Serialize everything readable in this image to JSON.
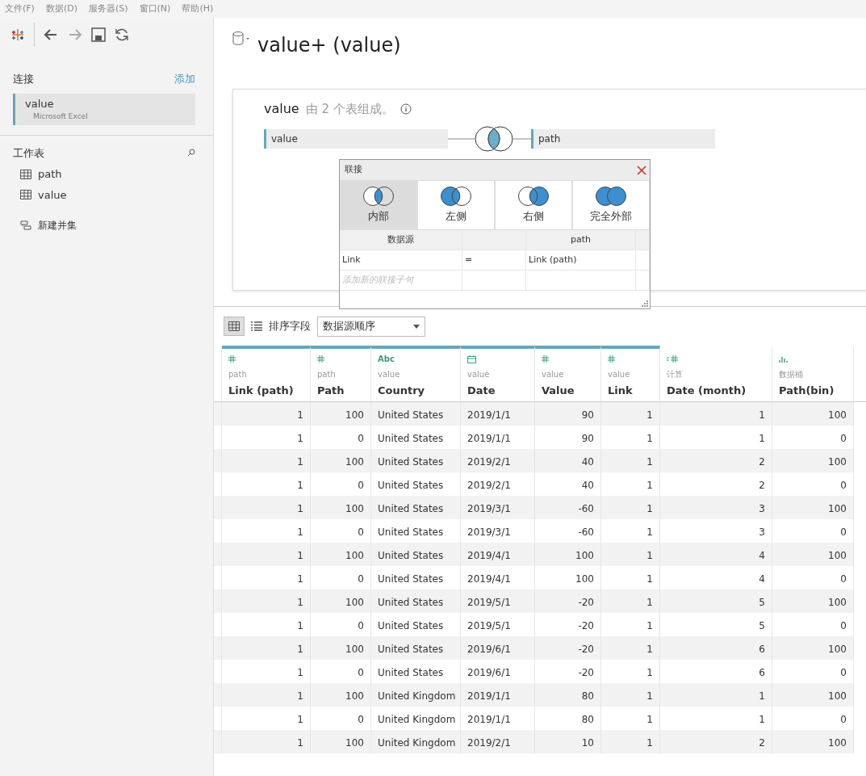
{
  "menu": [
    "文件(F)",
    "数据(D)",
    "服务器(S)",
    "窗口(N)",
    "帮助(H)"
  ],
  "sidebar": {
    "connections_label": "连接",
    "add_link": "添加",
    "connection": {
      "name": "value",
      "type": "Microsoft Excel"
    },
    "sheets_label": "工作表",
    "sheets": [
      "path",
      "value"
    ],
    "new_union": "新建并集"
  },
  "title": "value+ (value)",
  "canvas": {
    "source_name": "value",
    "source_desc": "由 2 个表组成。",
    "left_table": "value",
    "right_table": "path"
  },
  "join_dialog": {
    "title": "联接",
    "types": [
      {
        "label": "内部",
        "kind": "inner",
        "selected": true
      },
      {
        "label": "左侧",
        "kind": "left",
        "selected": false
      },
      {
        "label": "右侧",
        "kind": "right",
        "selected": false
      },
      {
        "label": "完全外部",
        "kind": "full",
        "selected": false
      }
    ],
    "headers": [
      "数据源",
      "path"
    ],
    "clause": {
      "left": "Link",
      "op": "=",
      "right": "Link (path)"
    },
    "add_placeholder": "添加新的联接子句"
  },
  "grid_toolbar": {
    "sort_label": "排序字段",
    "sort_value": "数据源顺序"
  },
  "table": {
    "columns": [
      {
        "name": "Link (path)",
        "source": "path",
        "kind": "number",
        "linked": true
      },
      {
        "name": "Path",
        "source": "path",
        "kind": "number",
        "linked": true
      },
      {
        "name": "Country",
        "source": "value",
        "kind": "string",
        "type_text": "Abc",
        "linked": true
      },
      {
        "name": "Date",
        "source": "value",
        "kind": "date",
        "linked": true
      },
      {
        "name": "Value",
        "source": "value",
        "kind": "number",
        "linked": true
      },
      {
        "name": "Link",
        "source": "value",
        "kind": "number",
        "linked": true
      },
      {
        "name": "Date  (month)",
        "source": "计算",
        "kind": "calc",
        "linked": false
      },
      {
        "name": "Path(bin)",
        "source": "数据桶",
        "kind": "bin",
        "linked": false
      }
    ],
    "rows": [
      [
        "1",
        "100",
        "United States",
        "2019/1/1",
        "90",
        "1",
        "1",
        "100"
      ],
      [
        "1",
        "0",
        "United States",
        "2019/1/1",
        "90",
        "1",
        "1",
        "0"
      ],
      [
        "1",
        "100",
        "United States",
        "2019/2/1",
        "40",
        "1",
        "2",
        "100"
      ],
      [
        "1",
        "0",
        "United States",
        "2019/2/1",
        "40",
        "1",
        "2",
        "0"
      ],
      [
        "1",
        "100",
        "United States",
        "2019/3/1",
        "-60",
        "1",
        "3",
        "100"
      ],
      [
        "1",
        "0",
        "United States",
        "2019/3/1",
        "-60",
        "1",
        "3",
        "0"
      ],
      [
        "1",
        "100",
        "United States",
        "2019/4/1",
        "100",
        "1",
        "4",
        "100"
      ],
      [
        "1",
        "0",
        "United States",
        "2019/4/1",
        "100",
        "1",
        "4",
        "0"
      ],
      [
        "1",
        "100",
        "United States",
        "2019/5/1",
        "-20",
        "1",
        "5",
        "100"
      ],
      [
        "1",
        "0",
        "United States",
        "2019/5/1",
        "-20",
        "1",
        "5",
        "0"
      ],
      [
        "1",
        "100",
        "United States",
        "2019/6/1",
        "-20",
        "1",
        "6",
        "100"
      ],
      [
        "1",
        "0",
        "United States",
        "2019/6/1",
        "-20",
        "1",
        "6",
        "0"
      ],
      [
        "1",
        "100",
        "United Kingdom",
        "2019/1/1",
        "80",
        "1",
        "1",
        "100"
      ],
      [
        "1",
        "0",
        "United Kingdom",
        "2019/1/1",
        "80",
        "1",
        "1",
        "0"
      ],
      [
        "1",
        "100",
        "United Kingdom",
        "2019/2/1",
        "10",
        "1",
        "2",
        "100"
      ]
    ]
  }
}
